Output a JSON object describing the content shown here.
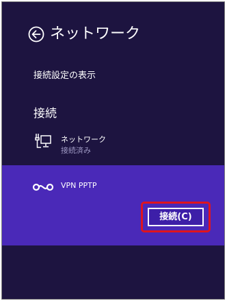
{
  "header": {
    "title": "ネットワーク",
    "back_icon": "back-arrow-icon"
  },
  "links": {
    "view_connection_settings": "接続設定の表示"
  },
  "connections": {
    "section_title": "接続",
    "network": {
      "icon": "wired-network-icon",
      "name": "ネットワーク",
      "status": "接続済み"
    },
    "vpn": {
      "icon": "vpn-icon",
      "name": "VPN PPTP",
      "connect_label": "接続(C)"
    }
  },
  "colors": {
    "background": "#1d1440",
    "selected_panel": "#4a29b8",
    "status_text": "#9d97c2",
    "highlight_border": "#e0141e",
    "frame_border": "#7a7a7a"
  }
}
